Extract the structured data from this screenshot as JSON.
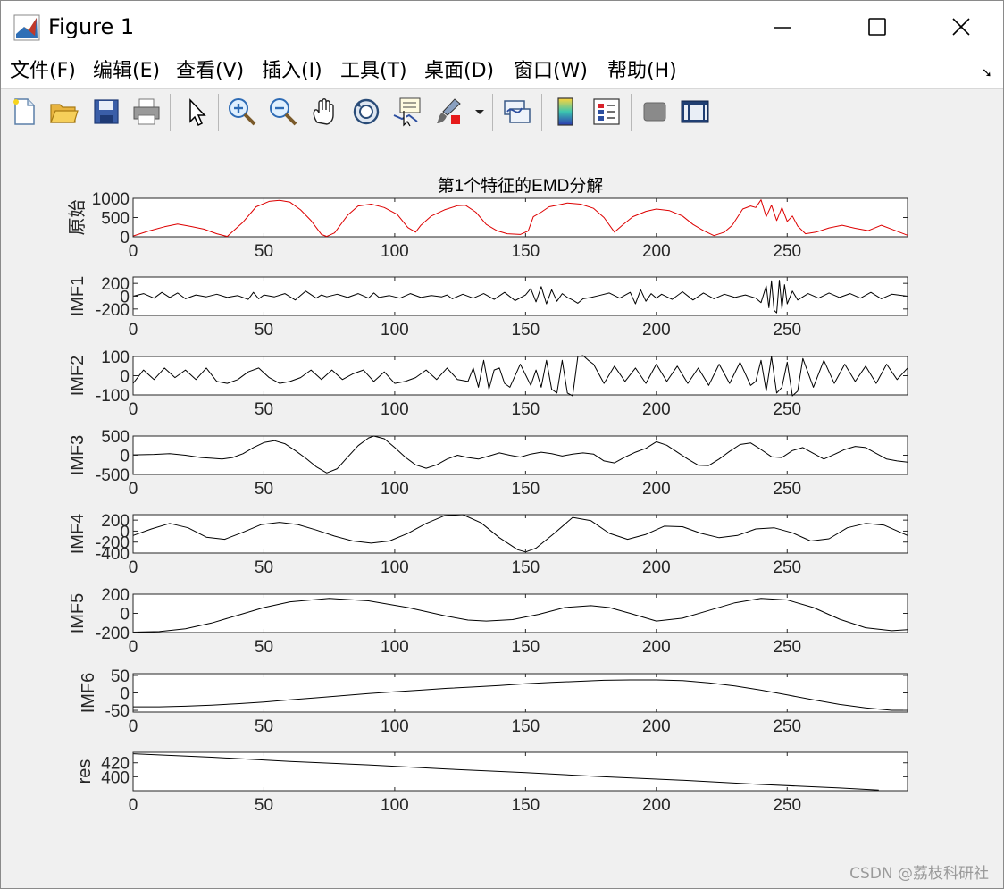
{
  "window": {
    "title": "Figure 1",
    "menu": [
      "文件(F)",
      "编辑(E)",
      "查看(V)",
      "插入(I)",
      "工具(T)",
      "桌面(D)",
      "窗口(W)",
      "帮助(H)"
    ],
    "toolbar_icons": [
      "new-figure-icon",
      "open-file-icon",
      "save-icon",
      "print-icon",
      "pointer-icon",
      "zoom-in-icon",
      "zoom-out-icon",
      "pan-hand-icon",
      "rotate-3d-icon",
      "data-cursor-icon",
      "brush-icon",
      "brush-dropdown-icon",
      "link-plot-icon",
      "colorbar-icon",
      "legend-icon",
      "hide-plot-tools-icon",
      "show-plot-tools-icon"
    ],
    "watermark": "CSDN @荔枝科研社"
  },
  "colors": {
    "original": "#dd0000",
    "imf": "#000000"
  },
  "chart_data": [
    {
      "type": "line",
      "title": "第1个特征的EMD分解",
      "ylabel": "原始",
      "xlim": [
        0,
        296
      ],
      "ylim": [
        0,
        1000
      ],
      "yticks": [
        "1000",
        "500",
        "0"
      ],
      "xticks": [
        "0",
        "50",
        "100",
        "150",
        "200",
        "250"
      ],
      "color": "#dd0000",
      "series": [
        {
          "x": [
            0,
            6,
            12,
            17,
            22,
            27,
            32,
            36,
            42,
            47,
            52,
            56,
            60,
            64,
            68,
            72,
            74,
            77,
            82,
            86,
            91,
            96,
            101,
            105,
            108,
            110,
            114,
            119,
            124,
            127,
            131,
            135,
            139,
            143,
            148,
            151,
            153,
            156,
            159,
            162,
            166,
            171,
            176,
            180,
            184,
            187,
            191,
            196,
            200,
            205,
            210,
            214,
            218,
            222,
            226,
            229,
            233,
            236,
            238,
            240,
            242,
            244,
            246,
            248,
            250,
            252,
            254,
            257,
            261,
            266,
            271,
            276,
            281,
            286,
            291,
            296
          ],
          "y": [
            20,
            150,
            260,
            330,
            270,
            200,
            80,
            10,
            380,
            780,
            920,
            950,
            900,
            700,
            420,
            60,
            10,
            100,
            560,
            800,
            850,
            760,
            580,
            240,
            120,
            300,
            540,
            700,
            810,
            820,
            640,
            320,
            160,
            80,
            60,
            150,
            520,
            640,
            780,
            820,
            880,
            850,
            740,
            500,
            120,
            300,
            520,
            660,
            720,
            680,
            540,
            320,
            160,
            30,
            120,
            300,
            720,
            800,
            760,
            960,
            520,
            820,
            420,
            760,
            400,
            540,
            280,
            80,
            120,
            230,
            300,
            220,
            160,
            300,
            170,
            40
          ]
        }
      ]
    },
    {
      "type": "line",
      "ylabel": "IMF1",
      "xlim": [
        0,
        296
      ],
      "ylim": [
        -300,
        300
      ],
      "yticks": [
        "200",
        "0",
        "-200"
      ],
      "xticks": [
        "0",
        "50",
        "100",
        "150",
        "200",
        "250"
      ],
      "color": "#000000",
      "series": [
        {
          "x": [
            0,
            4,
            8,
            11,
            14,
            17,
            20,
            24,
            28,
            32,
            36,
            40,
            44,
            46,
            48,
            50,
            54,
            58,
            62,
            66,
            70,
            72,
            74,
            78,
            82,
            86,
            90,
            92,
            94,
            98,
            102,
            106,
            110,
            114,
            118,
            120,
            122,
            126,
            130,
            134,
            138,
            142,
            146,
            150,
            152,
            154,
            156,
            158,
            160,
            162,
            164,
            166,
            168,
            170,
            172,
            175,
            178,
            182,
            186,
            190,
            192,
            194,
            196,
            198,
            200,
            202,
            206,
            210,
            214,
            218,
            222,
            226,
            230,
            234,
            238,
            240,
            242,
            243,
            244,
            245,
            246,
            247,
            248,
            249,
            250,
            252,
            254,
            258,
            262,
            266,
            270,
            274,
            278,
            282,
            286,
            290,
            296
          ],
          "y": [
            0,
            40,
            -30,
            60,
            -20,
            50,
            -40,
            20,
            -10,
            30,
            -20,
            10,
            -50,
            60,
            -40,
            20,
            -10,
            40,
            -60,
            80,
            -30,
            20,
            -10,
            30,
            -20,
            40,
            -30,
            50,
            -20,
            10,
            -30,
            40,
            -20,
            10,
            -10,
            20,
            -40,
            30,
            -30,
            40,
            -50,
            60,
            -70,
            20,
            120,
            -90,
            150,
            -120,
            100,
            -80,
            40,
            -20,
            -60,
            -110,
            -40,
            -20,
            10,
            50,
            -30,
            60,
            -120,
            100,
            -80,
            40,
            -30,
            30,
            -50,
            70,
            -60,
            50,
            -40,
            30,
            -20,
            20,
            -30,
            -100,
            160,
            -180,
            240,
            -220,
            -260,
            250,
            -200,
            180,
            -120,
            80,
            -60,
            40,
            -30,
            50,
            -20,
            40,
            -30,
            60,
            -40,
            30,
            0
          ]
        }
      ]
    },
    {
      "type": "line",
      "ylabel": "IMF2",
      "xlim": [
        0,
        296
      ],
      "ylim": [
        -100,
        100
      ],
      "yticks": [
        "100",
        "0",
        "-100"
      ],
      "xticks": [
        "0",
        "50",
        "100",
        "150",
        "200",
        "250"
      ],
      "color": "#000000",
      "series": [
        {
          "x": [
            0,
            4,
            8,
            12,
            16,
            20,
            24,
            28,
            32,
            36,
            40,
            44,
            48,
            52,
            56,
            60,
            64,
            68,
            72,
            76,
            80,
            84,
            88,
            92,
            96,
            100,
            104,
            108,
            112,
            116,
            120,
            124,
            128,
            130,
            132,
            134,
            136,
            138,
            140,
            142,
            144,
            148,
            152,
            154,
            156,
            158,
            160,
            162,
            164,
            166,
            168,
            170,
            172,
            174,
            176,
            180,
            184,
            188,
            192,
            196,
            200,
            204,
            208,
            212,
            216,
            220,
            224,
            228,
            232,
            236,
            238,
            240,
            242,
            244,
            246,
            248,
            250,
            252,
            254,
            256,
            260,
            264,
            268,
            272,
            276,
            280,
            284,
            288,
            292,
            296
          ],
          "y": [
            -40,
            30,
            -20,
            40,
            -10,
            30,
            -20,
            40,
            -30,
            -40,
            -20,
            20,
            40,
            -10,
            -40,
            -30,
            -10,
            30,
            -20,
            30,
            -20,
            10,
            30,
            -30,
            20,
            -40,
            -30,
            -10,
            30,
            -20,
            40,
            -20,
            -30,
            40,
            -60,
            80,
            -70,
            30,
            40,
            -40,
            -60,
            60,
            -50,
            30,
            -60,
            80,
            -70,
            -90,
            80,
            -90,
            -110,
            100,
            110,
            80,
            60,
            -40,
            50,
            -30,
            40,
            -40,
            60,
            -30,
            50,
            -40,
            40,
            -50,
            60,
            -40,
            70,
            -50,
            -30,
            80,
            -80,
            100,
            -90,
            -60,
            70,
            -110,
            -80,
            90,
            -60,
            80,
            -40,
            60,
            -30,
            50,
            -40,
            60,
            -20,
            40
          ]
        }
      ]
    },
    {
      "type": "line",
      "ylabel": "IMF3",
      "xlim": [
        0,
        296
      ],
      "ylim": [
        -500,
        500
      ],
      "yticks": [
        "500",
        "0",
        "-500"
      ],
      "xticks": [
        "0",
        "50",
        "100",
        "150",
        "200",
        "250"
      ],
      "color": "#000000",
      "series": [
        {
          "x": [
            0,
            8,
            14,
            20,
            26,
            30,
            34,
            38,
            42,
            46,
            50,
            54,
            58,
            62,
            66,
            70,
            74,
            78,
            82,
            86,
            90,
            92,
            96,
            100,
            104,
            108,
            112,
            116,
            120,
            124,
            128,
            132,
            136,
            140,
            144,
            148,
            152,
            156,
            160,
            164,
            168,
            172,
            176,
            180,
            184,
            188,
            192,
            196,
            200,
            204,
            208,
            212,
            216,
            220,
            224,
            228,
            232,
            236,
            240,
            244,
            248,
            252,
            256,
            260,
            264,
            268,
            272,
            276,
            280,
            284,
            288,
            292,
            296
          ],
          "y": [
            10,
            20,
            40,
            0,
            -60,
            -80,
            -100,
            -60,
            40,
            200,
            330,
            380,
            300,
            120,
            -80,
            -300,
            -460,
            -350,
            -50,
            250,
            450,
            500,
            430,
            200,
            -50,
            -250,
            -340,
            -250,
            -100,
            0,
            -60,
            -100,
            -20,
            60,
            0,
            -50,
            30,
            80,
            40,
            -20,
            30,
            60,
            30,
            -150,
            -200,
            -50,
            80,
            180,
            350,
            260,
            80,
            -100,
            -260,
            -270,
            -100,
            100,
            280,
            320,
            150,
            -40,
            -60,
            120,
            200,
            50,
            -100,
            20,
            150,
            230,
            200,
            50,
            -100,
            -150,
            -180
          ]
        }
      ]
    },
    {
      "type": "line",
      "ylabel": "IMF4",
      "xlim": [
        0,
        296
      ],
      "ylim": [
        -400,
        300
      ],
      "yticks": [
        "200",
        "0",
        "-200",
        "-400"
      ],
      "xticks": [
        "0",
        "50",
        "100",
        "150",
        "200",
        "250"
      ],
      "color": "#000000",
      "series": [
        {
          "x": [
            0,
            7,
            14,
            21,
            28,
            35,
            42,
            49,
            56,
            63,
            70,
            77,
            84,
            91,
            98,
            105,
            112,
            119,
            126,
            133,
            140,
            147,
            150,
            154,
            161,
            168,
            175,
            182,
            189,
            196,
            203,
            210,
            217,
            224,
            231,
            238,
            245,
            252,
            259,
            266,
            273,
            280,
            287,
            296
          ],
          "y": [
            -80,
            40,
            140,
            60,
            -110,
            -150,
            -20,
            120,
            160,
            120,
            20,
            -90,
            -180,
            -220,
            -180,
            -40,
            140,
            280,
            300,
            150,
            -120,
            -340,
            -380,
            -310,
            -40,
            250,
            190,
            -40,
            -150,
            -60,
            90,
            80,
            -40,
            -120,
            -80,
            40,
            60,
            -30,
            -180,
            -140,
            60,
            140,
            110,
            -80
          ]
        }
      ]
    },
    {
      "type": "line",
      "ylabel": "IMF5",
      "xlim": [
        0,
        296
      ],
      "ylim": [
        -200,
        200
      ],
      "yticks": [
        "200",
        "0",
        "-200"
      ],
      "xticks": [
        "0",
        "50",
        "100",
        "150",
        "200",
        "250"
      ],
      "color": "#000000",
      "series": [
        {
          "x": [
            0,
            10,
            20,
            30,
            40,
            50,
            60,
            75,
            90,
            105,
            120,
            128,
            135,
            145,
            155,
            165,
            175,
            182,
            190,
            200,
            210,
            220,
            230,
            240,
            250,
            260,
            270,
            280,
            290,
            296
          ],
          "y": [
            -195,
            -190,
            -160,
            -100,
            -20,
            60,
            120,
            155,
            130,
            60,
            -30,
            -70,
            -80,
            -65,
            -10,
            60,
            80,
            60,
            0,
            -80,
            -50,
            30,
            110,
            155,
            140,
            60,
            -60,
            -150,
            -180,
            -170
          ]
        }
      ]
    },
    {
      "type": "line",
      "ylabel": "IMF6",
      "xlim": [
        0,
        296
      ],
      "ylim": [
        -55,
        55
      ],
      "yticks": [
        "50",
        "0",
        "-50"
      ],
      "xticks": [
        "0",
        "50",
        "100",
        "150",
        "200",
        "250"
      ],
      "color": "#000000",
      "series": [
        {
          "x": [
            0,
            10,
            20,
            30,
            40,
            50,
            60,
            70,
            80,
            90,
            100,
            110,
            120,
            130,
            140,
            150,
            160,
            170,
            180,
            190,
            200,
            210,
            220,
            230,
            240,
            250,
            260,
            270,
            280,
            290,
            296
          ],
          "y": [
            -40,
            -40,
            -38,
            -35,
            -31,
            -26,
            -20,
            -14,
            -8,
            -2,
            3,
            8,
            13,
            17,
            21,
            26,
            30,
            33,
            36,
            37,
            37,
            35,
            29,
            20,
            8,
            -6,
            -20,
            -33,
            -43,
            -50,
            -50
          ]
        }
      ]
    },
    {
      "type": "line",
      "ylabel": "res",
      "xlim": [
        0,
        296
      ],
      "ylim": [
        380,
        435
      ],
      "yticks": [
        "420",
        "400"
      ],
      "xticks": [
        "0",
        "50",
        "100",
        "150",
        "200",
        "250"
      ],
      "color": "#000000",
      "series": [
        {
          "x": [
            0,
            30,
            60,
            90,
            120,
            150,
            180,
            210,
            240,
            270,
            285
          ],
          "y": [
            433,
            428,
            422,
            417,
            411,
            406,
            400,
            395,
            389,
            384,
            381
          ]
        }
      ]
    }
  ]
}
